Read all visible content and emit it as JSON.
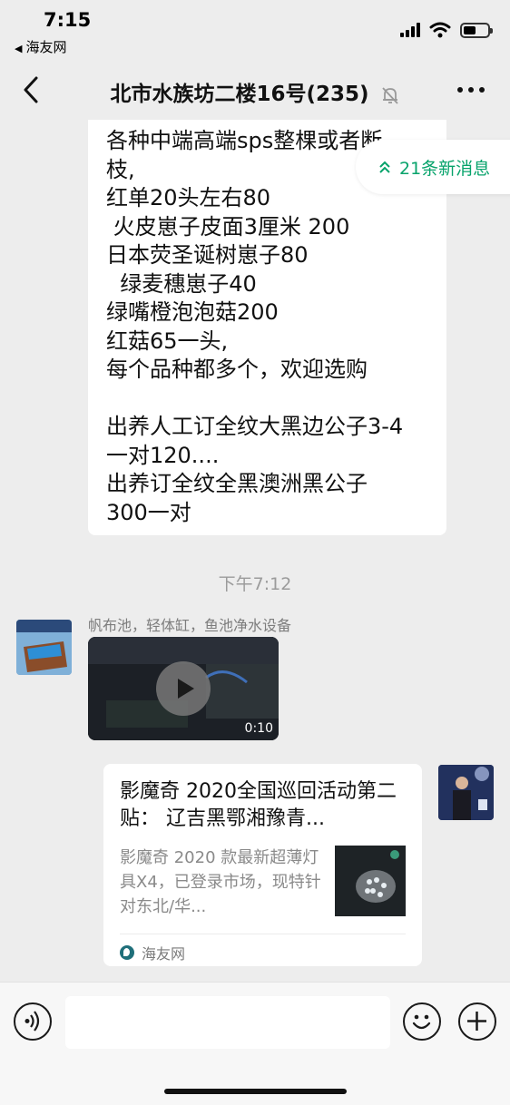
{
  "status_bar": {
    "time": "7:15",
    "back_app": "海友网"
  },
  "nav": {
    "title": "北市水族坊二楼16号(235)"
  },
  "messages": {
    "text_message": "各种中端高端sps整棵或者断\n枝,\n红单20头左右80\n 火皮崽子皮面3厘米 200\n日本荧圣诞树崽子80\n  绿麦穗崽子40\n绿嘴橙泡泡菇200\n红菇65一头,\n每个品种都多个，欢迎选购\n\n出养人工订全纹大黑边公子3-4\n一对120....\n出养订全纹全黑澳洲黑公子\n300一对",
    "new_message_indicator": "21条新消息",
    "timestamp": "下午7:12",
    "video_message": {
      "sender_name": "帆布池，轻体缸，鱼池净水设备",
      "duration": "0:10"
    },
    "link_card": {
      "title": "影魔奇 2020全国巡回活动第二贴： 辽吉黑鄂湘豫青...",
      "description": "影魔奇 2020 款最新超薄灯具X4，已登录市场，现特针对东北/华...",
      "source": "海友网"
    }
  },
  "colors": {
    "accent_green": "#07a36b",
    "background": "#ededed"
  }
}
